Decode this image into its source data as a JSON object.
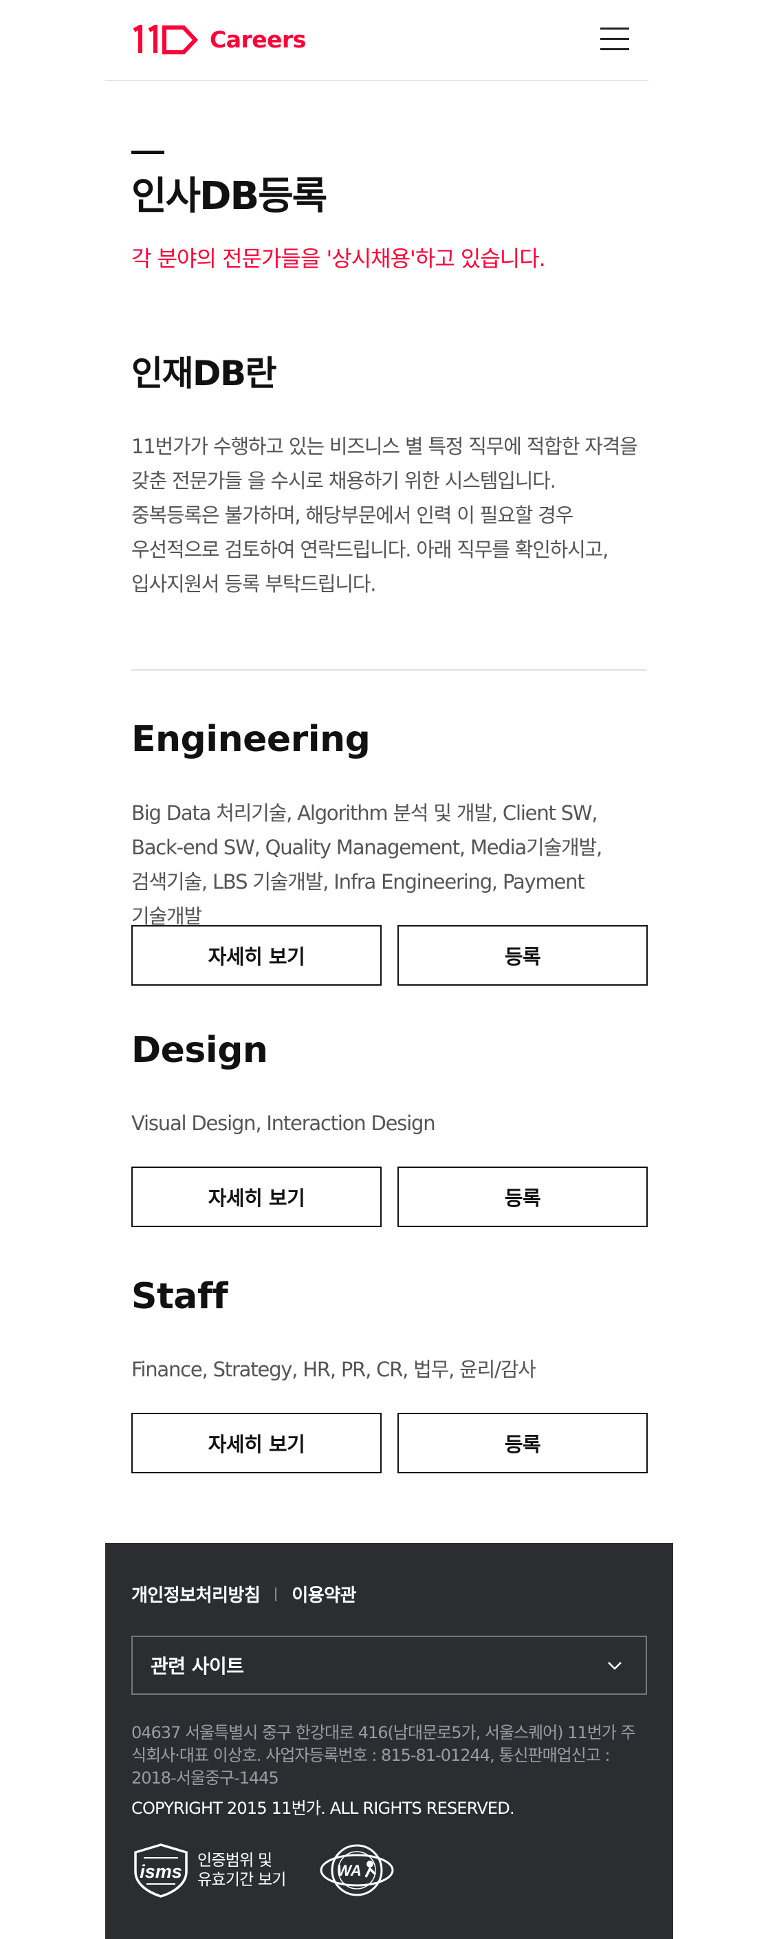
{
  "header": {
    "logo_text": "Careers",
    "brand_color": "#ff0038",
    "menu_icon": "hamburger-menu-icon"
  },
  "page": {
    "title": "인사DB등록",
    "subtitle": "각 분야의 전문가들을 '상시채용'하고 있습니다."
  },
  "intro": {
    "title": "인재DB란",
    "description": "11번가가 수행하고 있는 비즈니스 별 특정 직무에 적합한 자격을 갖춘 전문가들 을 수시로 채용하기 위한 시스템입니다. 중복등록은 불가하며, 해당부문에서 인력 이 필요할 경우 우선적으로 검토하여 연락드립니다. 아래 직무를 확인하시고, 입사지원서 등록 부탁드립니다."
  },
  "sections": [
    {
      "title": "Engineering",
      "description": "Big Data 처리기술, Algorithm 분석 및 개발, Client SW, Back-end SW, Quality Management, Media기술개발, 검색기술, LBS 기술개발, Infra Engineering, Payment 기술개발",
      "detail_label": "자세히 보기",
      "apply_label": "등록"
    },
    {
      "title": "Design",
      "description": "Visual Design, Interaction Design",
      "detail_label": "자세히 보기",
      "apply_label": "등록"
    },
    {
      "title": "Staff",
      "description": "Finance, Strategy, HR, PR, CR, 법무, 윤리/감사",
      "detail_label": "자세히 보기",
      "apply_label": "등록"
    }
  ],
  "footer": {
    "privacy_link": "개인정보처리방침",
    "terms_link": "이용약관",
    "related_sites_label": "관련 사이트",
    "address": "04637 서울특별시 중구 한강대로 416(남대문로5가, 서울스퀘어) 11번가 주식회사·대표 이상호. 사업자등록번호 : 815-81-01244, 통신판매업신고 : 2018-서울중구-1445",
    "copyright": "COPYRIGHT 2015 11번가. ALL RIGHTS RESERVED.",
    "isms_label_line1": "인증범위 및",
    "isms_label_line2": "유효기간 보기",
    "isms_logo_text": "isms",
    "wa_logo_text": "WA",
    "background_color": "#2b2d31"
  }
}
